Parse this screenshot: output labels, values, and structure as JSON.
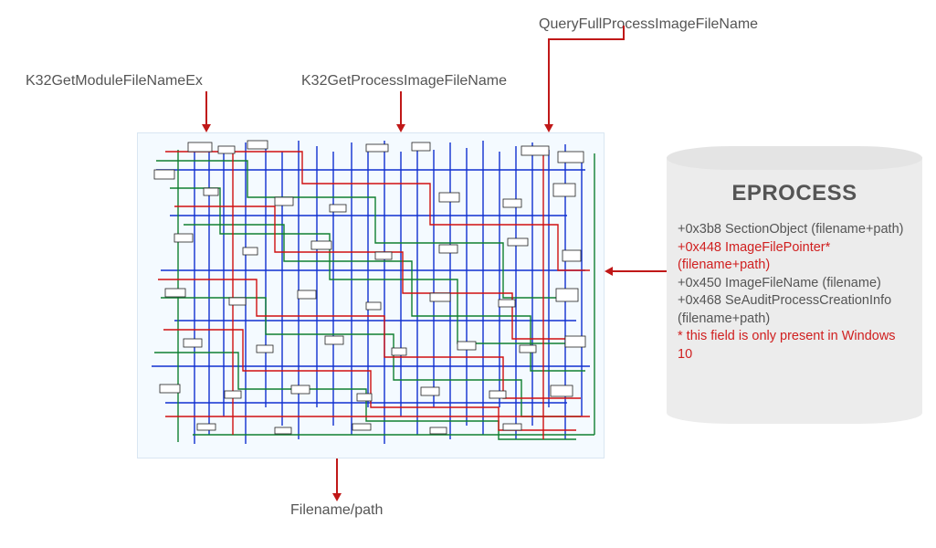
{
  "labels": {
    "top_right": "QueryFullProcessImageFileName",
    "left": "K32GetModuleFileNameEx",
    "middle": "K32GetProcessImageFileName",
    "bottom": "Filename/path"
  },
  "eprocess": {
    "title": "EPROCESS",
    "fields": [
      {
        "text": "+0x3b8 SectionObject (filename+path)",
        "highlight": false
      },
      {
        "text": "+0x448 ImageFilePointer* (filename+path)",
        "highlight": true
      },
      {
        "text": "+0x450 ImageFileName (filename)",
        "highlight": false
      },
      {
        "text": "+0x468 SeAuditProcessCreationInfo (filename+path)",
        "highlight": false
      },
      {
        "text": "* this field is only present in Windows 10",
        "highlight": true
      }
    ]
  },
  "colors": {
    "arrow": "#c01818",
    "graph_bg": "#f4faff",
    "graph_blue": "#1030d0",
    "graph_green": "#108030",
    "graph_red": "#d01010",
    "cylinder_fill": "#ececec",
    "highlight_text": "#d02020"
  },
  "arrows": [
    {
      "name": "arrow-queryfull",
      "from": "label-top-right",
      "to": "graph-box"
    },
    {
      "name": "arrow-k32module",
      "from": "label-left",
      "to": "graph-box"
    },
    {
      "name": "arrow-k32process",
      "from": "label-middle",
      "to": "graph-box"
    },
    {
      "name": "arrow-filename",
      "from": "graph-box",
      "to": "label-bottom"
    },
    {
      "name": "arrow-eprocess",
      "from": "eprocess-cylinder",
      "to": "graph-box"
    }
  ]
}
